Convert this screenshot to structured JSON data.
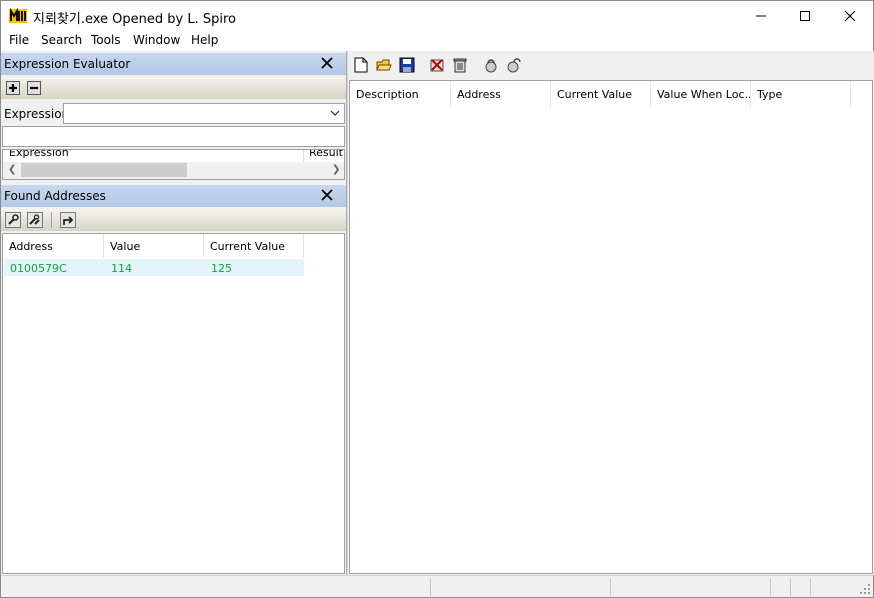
{
  "window": {
    "title": "지뢰찾기.exe Opened by L. Spiro",
    "controls": {
      "minimize": "minimize-icon",
      "maximize": "maximize-icon",
      "close": "close-icon"
    }
  },
  "menu": [
    "File",
    "Search",
    "Tools",
    "Window",
    "Help"
  ],
  "expression_evaluator": {
    "title": "Expression Evaluator",
    "expression_label": "Expression:",
    "expression_value": "",
    "input_value": "",
    "columns": [
      "Expression",
      "Result"
    ]
  },
  "found_addresses": {
    "title": "Found Addresses",
    "columns": [
      "Address",
      "Value",
      "Current Value"
    ],
    "rows": [
      {
        "address": "0100579C",
        "value": "114",
        "current_value": "125"
      }
    ]
  },
  "main_list": {
    "columns": [
      "Description",
      "Address",
      "Current Value",
      "Value When Loc...",
      "Type"
    ]
  },
  "colors": {
    "panel_header": "#b3c8e6",
    "found_text": "#0aa83a",
    "selected_row": "#e5f3fb"
  }
}
